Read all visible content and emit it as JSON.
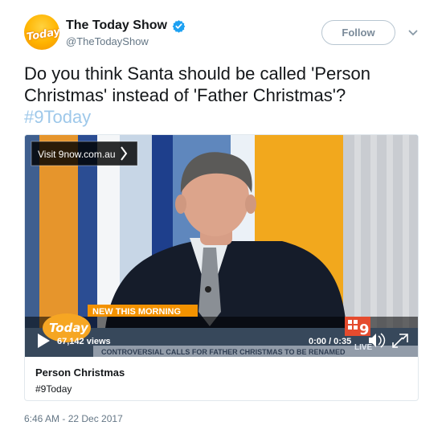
{
  "account": {
    "display_name": "The Today Show",
    "handle": "@TheTodayShow",
    "avatar_text": "Today"
  },
  "follow_label": "Follow",
  "tweet": {
    "text": "Do you think Santa should be called 'Person Christmas' instead of 'Father Christmas'?",
    "hashtag": "#9Today"
  },
  "video": {
    "overlay_link": "Visit 9now.com.au",
    "lower_third": "NEW THIS MORNING",
    "ticker": "CONTROVERSIAL CALLS FOR FATHER CHRISTMAS TO BE RENAMED",
    "show_logo": "Today",
    "views": "67,142 views",
    "time": "0:00 / 0:35",
    "channel_text": "LIVE"
  },
  "card": {
    "title": "Person Christmas",
    "subtitle": "#9Today"
  },
  "timestamp": "6:46 AM - 22 Dec 2017",
  "colors": {
    "verified": "#1da1f2",
    "hashtag": "#9ec8ea",
    "lower_third": "#f39200"
  }
}
